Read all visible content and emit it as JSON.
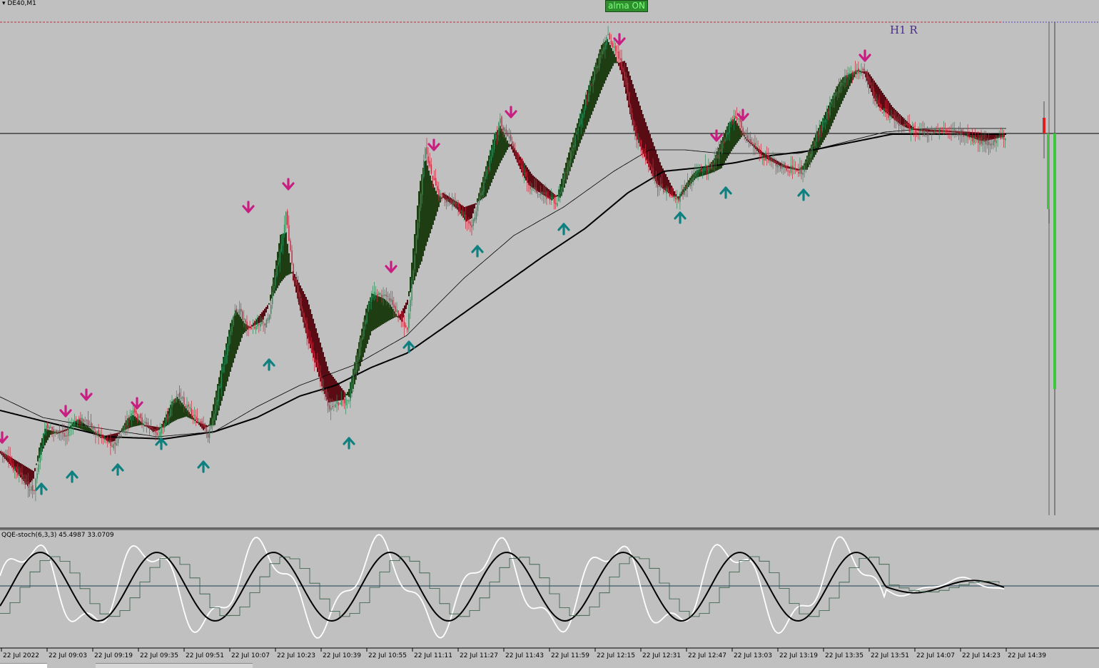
{
  "header": {
    "symbol_label": "DE40,M1",
    "toggle_button_label": "alma ON",
    "level_label": "H1 R"
  },
  "indicator": {
    "label": "QQE-stoch(6,3,3) 45.4987 33.0709"
  },
  "time_axis": {
    "ticks": [
      "22 Jul 2022",
      "22 Jul 09:03",
      "22 Jul 09:19",
      "22 Jul 09:35",
      "22 Jul 09:51",
      "22 Jul 10:07",
      "22 Jul 10:23",
      "22 Jul 10:39",
      "22 Jul 10:55",
      "22 Jul 11:11",
      "22 Jul 11:27",
      "22 Jul 11:43",
      "22 Jul 11:59",
      "22 Jul 12:15",
      "22 Jul 12:31",
      "22 Jul 12:47",
      "22 Jul 13:03",
      "22 Jul 13:19",
      "22 Jul 13:35",
      "22 Jul 13:51",
      "22 Jul 14:07",
      "22 Jul 14:23",
      "22 Jul 14:39"
    ]
  },
  "colors": {
    "background": "#c0c0c0",
    "bull_candle": "#2e8b57",
    "bear_candle": "#c8283c",
    "bull_cloud": "#1e3d12",
    "bear_cloud": "#5a0c14",
    "up_arrow": "#0f8080",
    "down_arrow": "#c81e82",
    "toggle_button": "#2f8f2f",
    "histogram_bar": "#3cc83c"
  }
}
